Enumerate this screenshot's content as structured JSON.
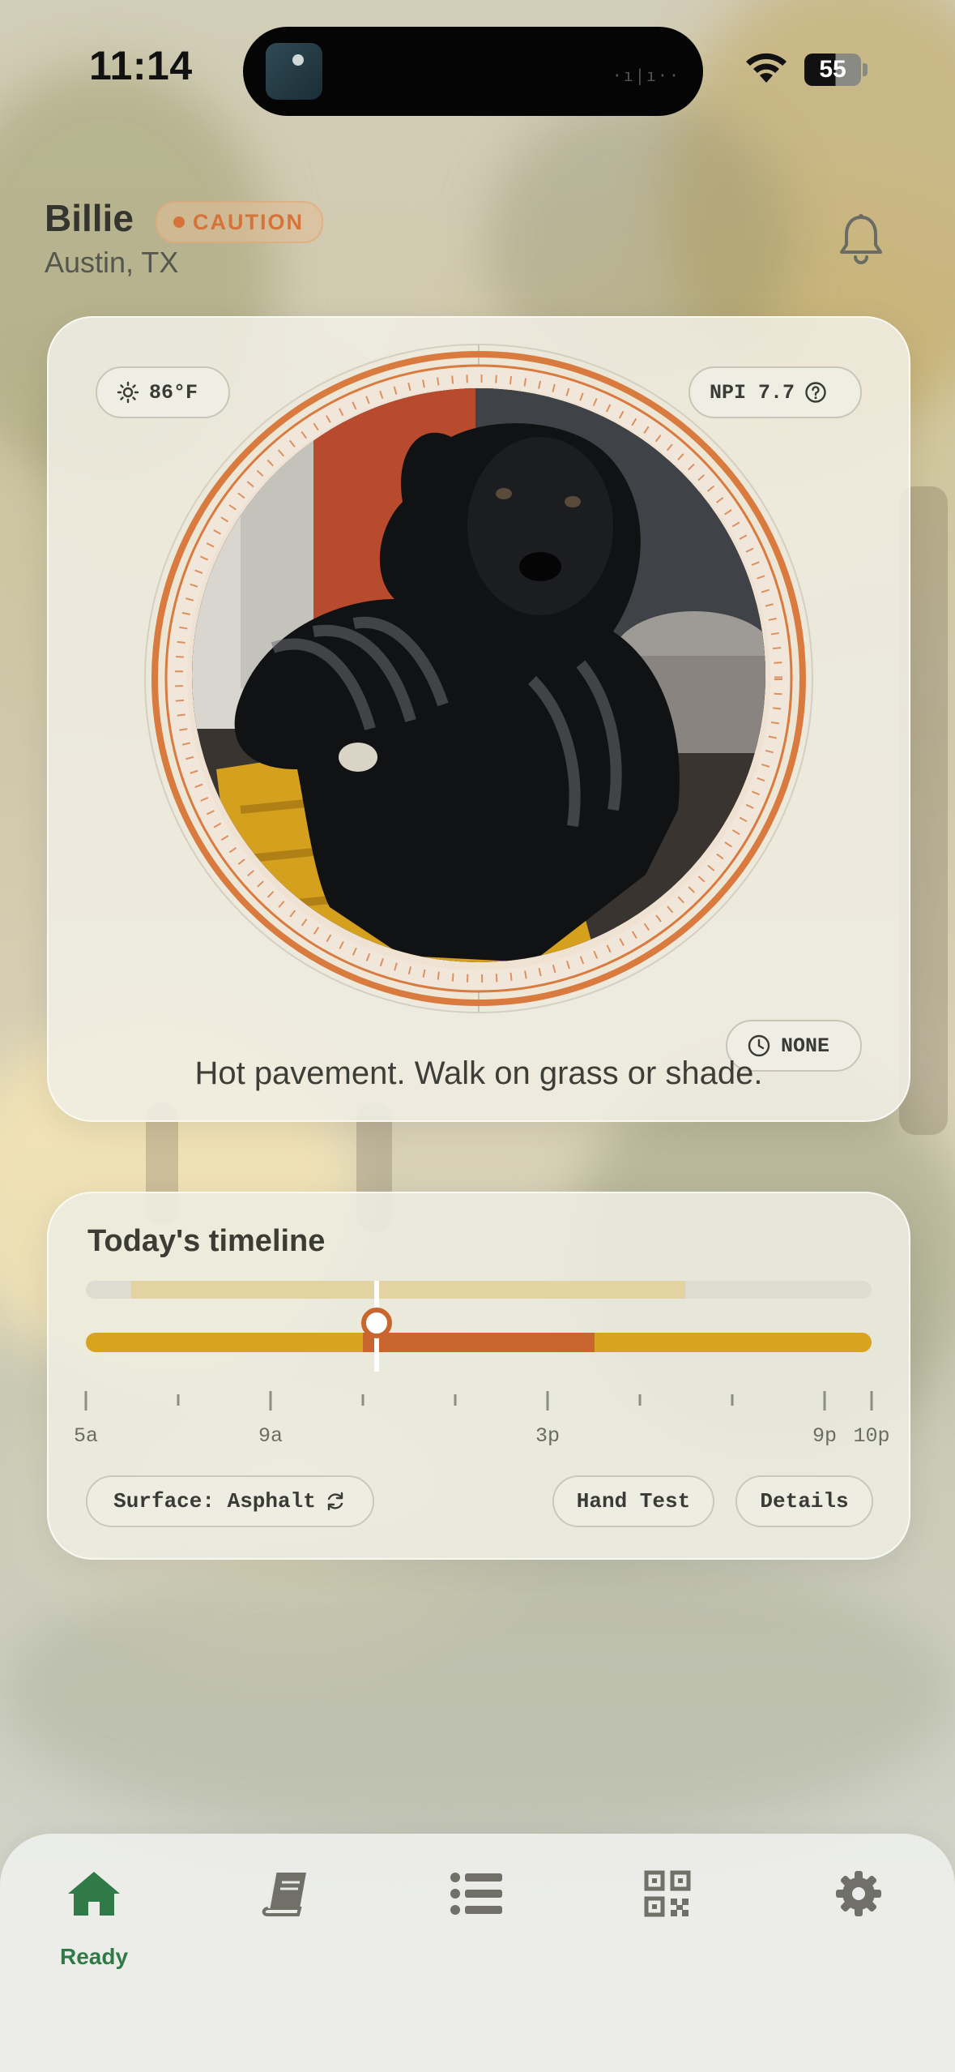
{
  "status_bar": {
    "time": "11:14",
    "battery": "55"
  },
  "header": {
    "pet_name": "Billie",
    "status_badge": "CAUTION",
    "location": "Austin, TX"
  },
  "hero_card": {
    "temperature": "86°F",
    "npi_label": "NPI 7.7",
    "time_chip": "NONE",
    "message": "Hot pavement. Walk on grass or shade."
  },
  "timeline": {
    "title": "Today's timeline",
    "tick_labels": [
      "5a",
      "9a",
      "3p",
      "9p",
      "10p"
    ],
    "surface_button": "Surface: Asphalt",
    "hand_test_button": "Hand Test",
    "details_button": "Details"
  },
  "tab_bar": {
    "active_label": "Ready",
    "tabs": [
      "home-icon",
      "book-icon",
      "list-icon",
      "qr-code-icon",
      "gear-icon"
    ]
  },
  "colors": {
    "accent_orange": "#d5733a",
    "warn_yellow": "#d8a321",
    "active_green": "#2f7a47"
  }
}
